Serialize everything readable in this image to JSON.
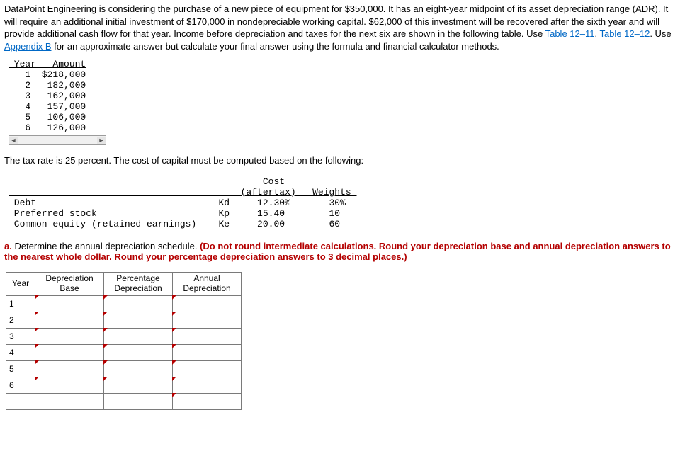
{
  "intro": {
    "p1a": "DataPoint Engineering is considering the purchase of a new piece of equipment for $350,000. It has an eight-year midpoint of its asset depreciation range (ADR). It will require an additional initial investment of $170,000 in nondepreciable working capital. $62,000 of this investment will be recovered after the sixth year and will provide additional cash flow for that year. Income before depreciation and taxes for the next six are shown in the following table. Use ",
    "link1": "Table 12–11",
    "sep1": ", ",
    "link2": "Table 12–12",
    "p1b": ". Use ",
    "link3": "Appendix B",
    "p1c": " for an approximate answer but calculate your final answer using the formula and financial calculator methods."
  },
  "income_table": {
    "header": " Year   Amount",
    "rows": [
      "   1  $218,000",
      "   2   182,000",
      "   3   162,000",
      "   4   157,000",
      "   5   106,000",
      "   6   126,000"
    ]
  },
  "midtext": "The tax rate is 25 percent. The cost of capital must be computed based on the following:",
  "cost_table": {
    "l1": "                                              Cost",
    "l2": "                                          (aftertax)   Weights ",
    "l3": " Debt                                 Kd     12.30%       30% ",
    "l4": " Preferred stock                      Kp     15.40        10  ",
    "l5": " Common equity (retained earnings)    Ke     20.00        60  "
  },
  "instr": {
    "lead": "a. ",
    "q": "Determine the annual depreciation schedule. ",
    "bold": "(Do not round intermediate calculations. Round your depreciation base and annual depreciation answers to the nearest whole dollar. Round your percentage depreciation answers to 3 decimal places.)"
  },
  "grid": {
    "headers": {
      "year": "Year",
      "base": "Depreciation\nBase",
      "pct": "Percentage\nDepreciation",
      "ann": "Annual\nDepreciation"
    },
    "rows": [
      "1",
      "2",
      "3",
      "4",
      "5",
      "6",
      ""
    ]
  }
}
